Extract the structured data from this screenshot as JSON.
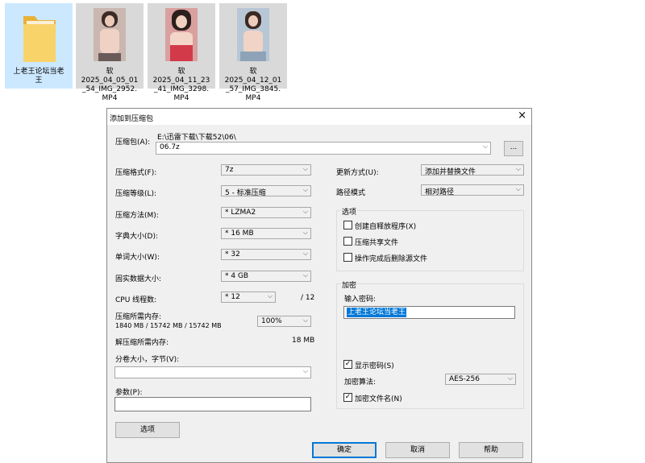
{
  "desktop": {
    "files": [
      {
        "name": "上老王论坛当老\n王",
        "type": "folder"
      },
      {
        "name": "软\n2025_04_05_01\n_54_IMG_2952.\nMP4",
        "type": "video"
      },
      {
        "name": "软\n2025_04_11_23\n_41_IMG_3298.\nMP4",
        "type": "video"
      },
      {
        "name": "软\n2025_04_12_01\n_57_IMG_3845.\nMP4",
        "type": "video"
      }
    ]
  },
  "dialog": {
    "title": "添加到压缩包",
    "close_icon": "×",
    "archive_label": "压缩包(A):",
    "archive_path": "E:\\迅雷下载\\下载52\\06\\",
    "archive_name": "06.7z",
    "browse_label": "...",
    "left": {
      "format_label": "压缩格式(F):",
      "format_value": "7z",
      "level_label": "压缩等级(L):",
      "level_value": "5 - 标准压缩",
      "method_label": "压缩方法(M):",
      "method_value": "* LZMA2",
      "dict_label": "字典大小(D):",
      "dict_value": "* 16 MB",
      "word_label": "单词大小(W):",
      "word_value": "* 32",
      "solid_label": "固实数据大小:",
      "solid_value": "* 4 GB",
      "cpu_label": "CPU 线程数:",
      "cpu_value": "* 12",
      "cpu_total": "/ 12",
      "mem_label": "压缩所需内存:",
      "mem_value": "1840 MB / 15742 MB / 15742 MB",
      "mem_percent": "100%",
      "decomp_label": "解压缩所需内存:",
      "decomp_value": "18 MB",
      "split_label": "分卷大小，字节(V):",
      "split_value": "",
      "params_label": "参数(P):",
      "params_value": "",
      "options_button": "选项"
    },
    "right": {
      "update_label": "更新方式(U):",
      "update_value": "添加并替换文件",
      "path_label": "路径模式",
      "path_value": "相对路径",
      "options_title": "选项",
      "opt_sfx": "创建自释放程序(X)",
      "opt_shared": "压缩共享文件",
      "opt_delete": "操作完成后删除源文件",
      "enc_title": "加密",
      "pwd_label": "输入密码:",
      "pwd_value": "上老王论坛当老王",
      "show_pwd": "显示密码(S)",
      "enc_method_label": "加密算法:",
      "enc_method_value": "AES-256",
      "enc_names": "加密文件名(N)"
    },
    "buttons": {
      "ok": "确定",
      "cancel": "取消",
      "help": "帮助"
    },
    "checks": {
      "show_pwd": "✓",
      "enc_names": "✓"
    }
  }
}
